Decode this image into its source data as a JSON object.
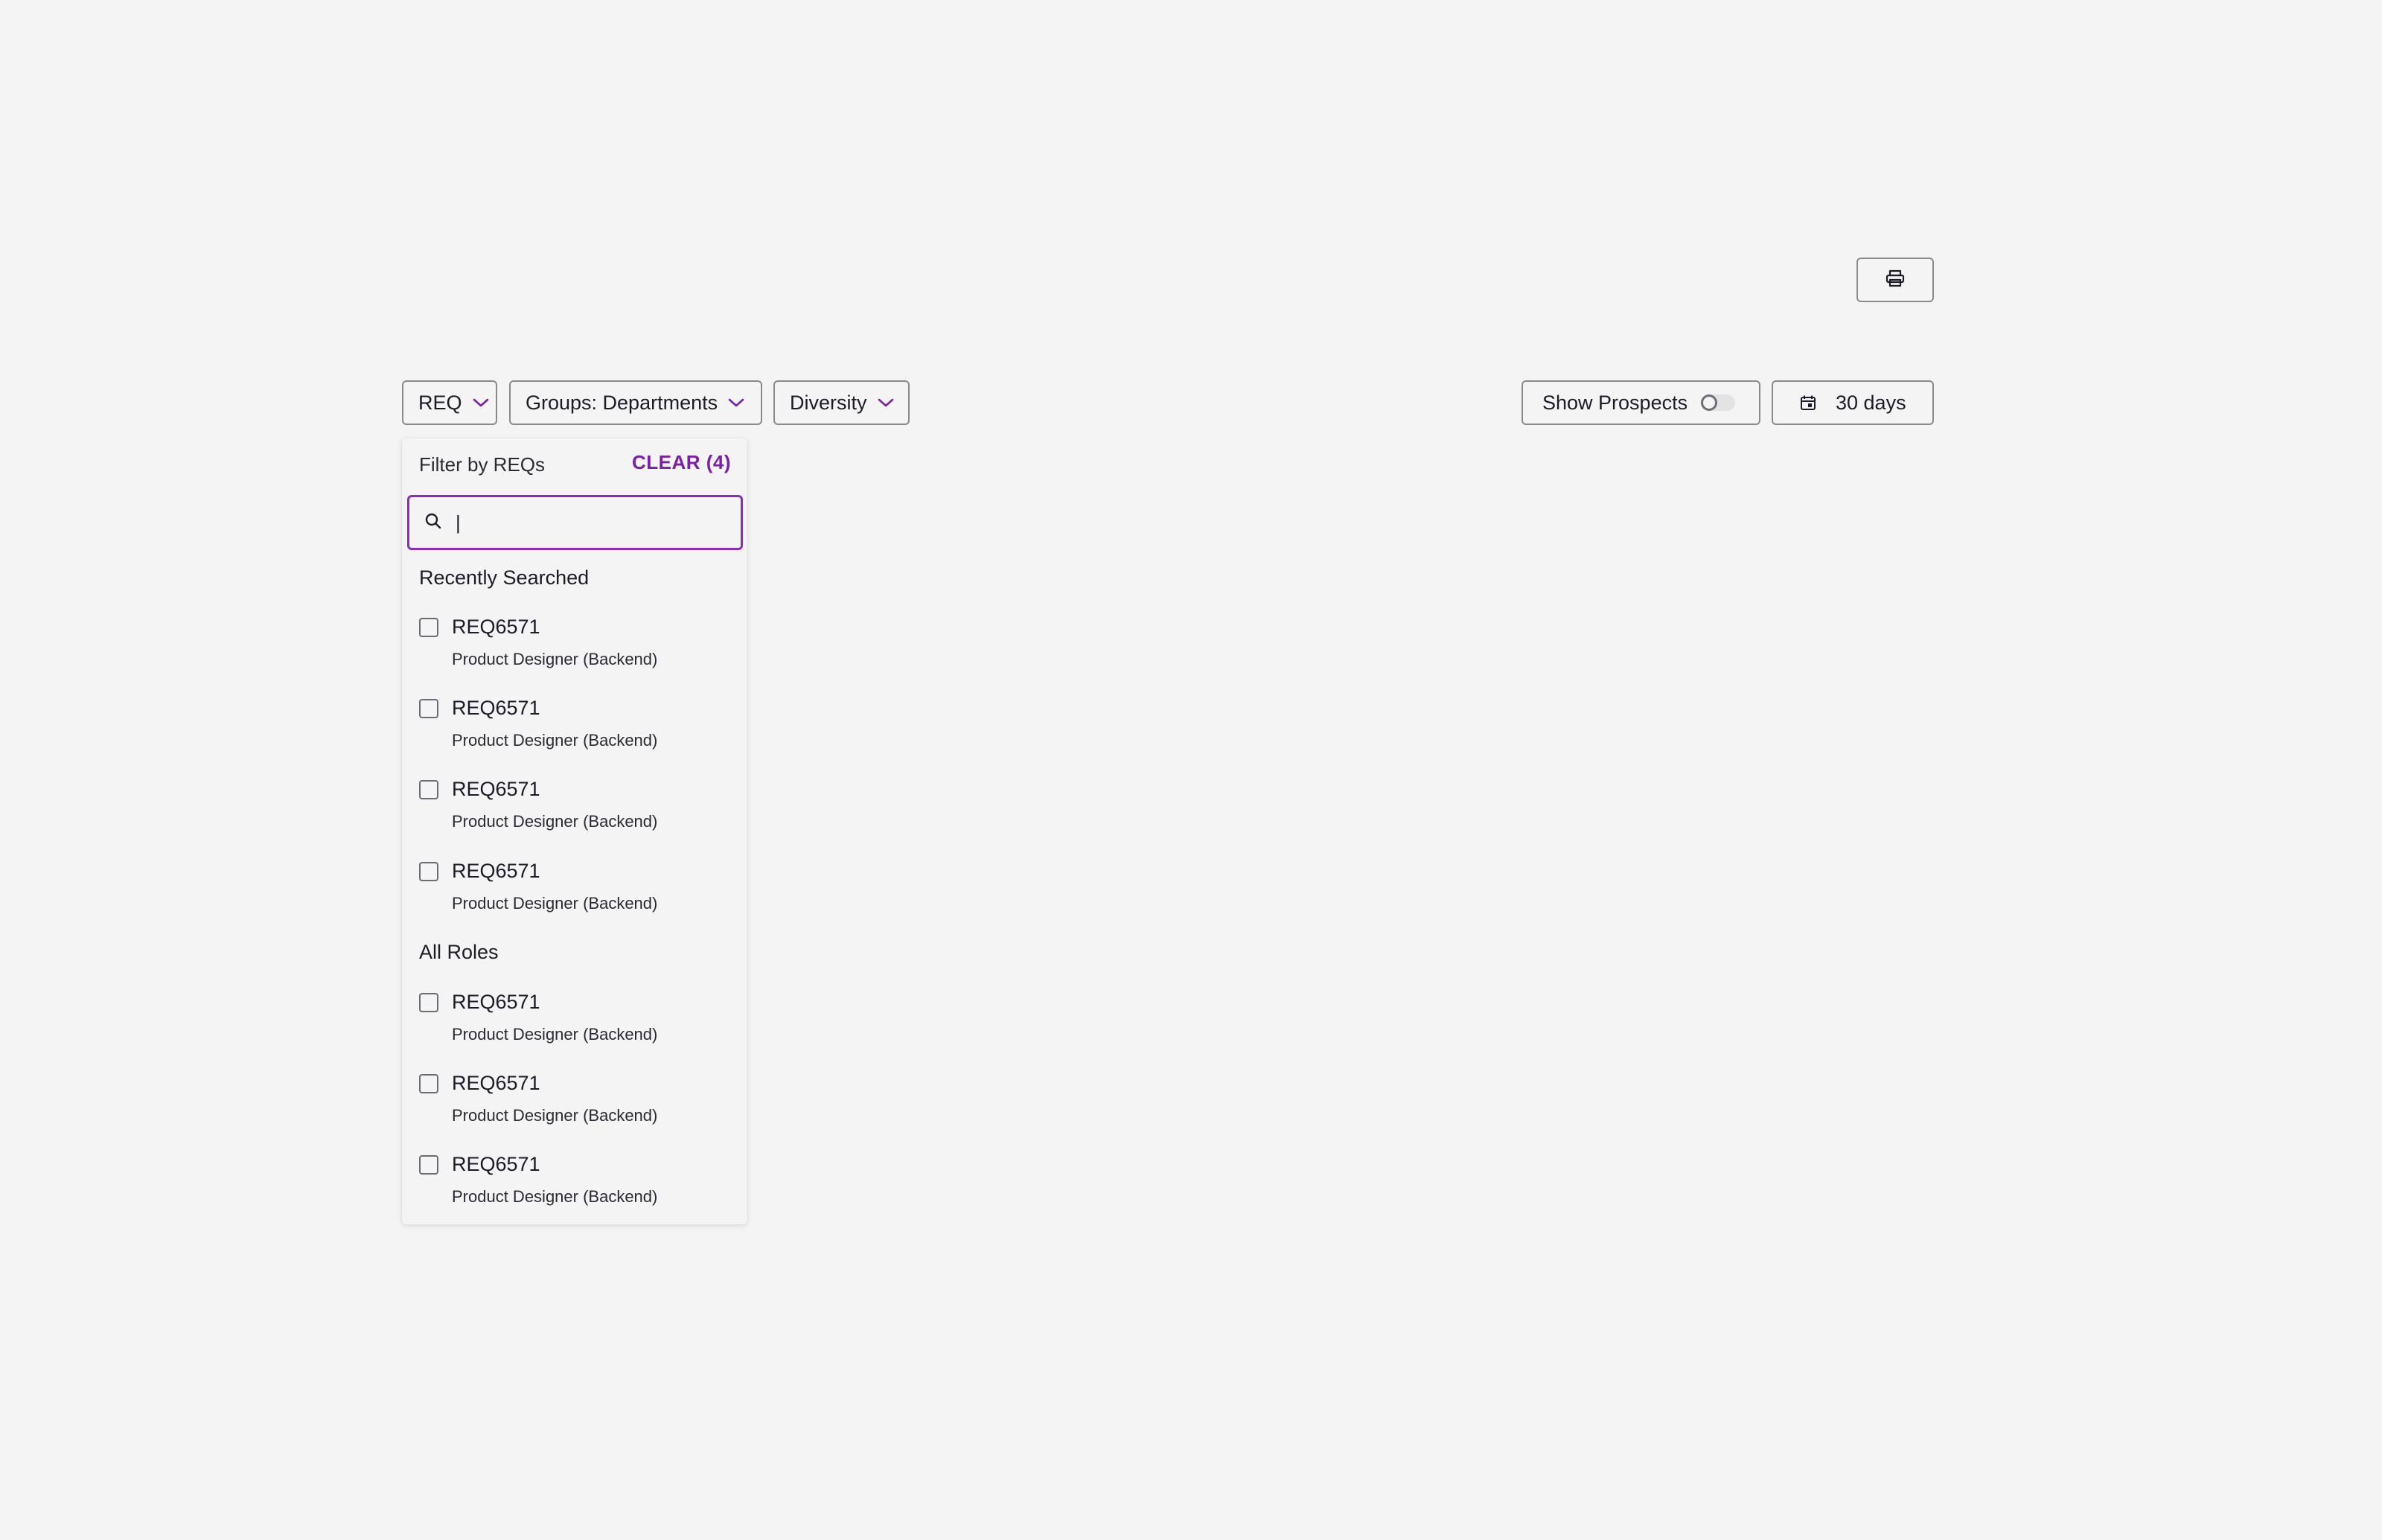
{
  "toolbar": {
    "req_label": "REQ",
    "groups_label": "Groups: Departments",
    "diversity_label": "Diversity",
    "show_prospects_label": "Show Prospects",
    "show_prospects_enabled": false,
    "date_range_label": "30 days"
  },
  "dropdown": {
    "title": "Filter by REQs",
    "clear_label": "CLEAR (4)",
    "search": {
      "value": "|",
      "placeholder": ""
    },
    "recent_label": "Recently Searched",
    "recent": [
      {
        "code": "REQ6571",
        "role": "Product Designer (Backend)",
        "checked": false
      },
      {
        "code": "REQ6571",
        "role": "Product Designer (Backend)",
        "checked": false
      },
      {
        "code": "REQ6571",
        "role": "Product Designer (Backend)",
        "checked": false
      },
      {
        "code": "REQ6571",
        "role": "Product Designer (Backend)",
        "checked": false
      }
    ],
    "all_label": "All Roles",
    "all": [
      {
        "code": "REQ6571",
        "role": "Product Designer (Backend)",
        "checked": false
      },
      {
        "code": "REQ6571",
        "role": "Product Designer (Backend)",
        "checked": false
      },
      {
        "code": "REQ6571",
        "role": "Product Designer (Backend)",
        "checked": false
      }
    ]
  },
  "colors": {
    "accent": "#7a1fa8",
    "background": "#f4f4f4",
    "border": "#8a8a8a"
  },
  "icons": {
    "print": "printer-icon",
    "chevron": "chevron-down-icon",
    "calendar": "calendar-icon",
    "search": "search-icon"
  }
}
